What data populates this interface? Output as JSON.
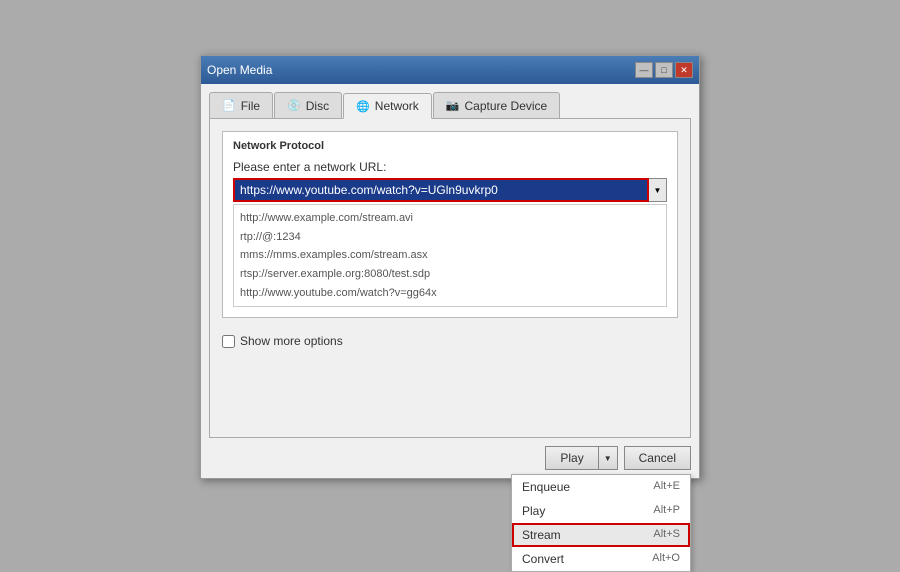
{
  "window": {
    "title": "Open Media",
    "controls": {
      "minimize": "—",
      "restore": "□",
      "close": "✕"
    }
  },
  "tabs": [
    {
      "label": "File",
      "icon": "📄",
      "active": false
    },
    {
      "label": "Disc",
      "icon": "💿",
      "active": false
    },
    {
      "label": "Network",
      "icon": "🌐",
      "active": true
    },
    {
      "label": "Capture Device",
      "icon": "📷",
      "active": false
    }
  ],
  "network_protocol": {
    "group_title": "Network Protocol",
    "field_label": "Please enter a network URL:",
    "url_value": "https://www.youtube.com/watch?v=UGln9uvkrp0",
    "dropdown_items": [
      "http://www.example.com/stream.avi",
      "rtp://@:1234",
      "mms://mms.examples.com/stream.asx",
      "rtsp://server.example.org:8080/test.sdp",
      "http://www.youtube.com/watch?v=gg64x"
    ]
  },
  "options": {
    "show_more_label": "Show more options"
  },
  "buttons": {
    "play": "Play",
    "cancel": "Cancel",
    "menu": {
      "enqueue": {
        "label": "Enqueue",
        "shortcut": "Alt+E"
      },
      "play": {
        "label": "Play",
        "shortcut": "Alt+P"
      },
      "stream": {
        "label": "Stream",
        "shortcut": "Alt+S"
      },
      "convert": {
        "label": "Convert",
        "shortcut": "Alt+O"
      }
    }
  }
}
